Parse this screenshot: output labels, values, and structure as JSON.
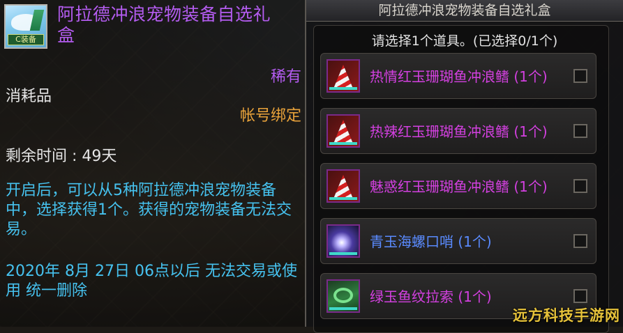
{
  "tooltip": {
    "item_name": "阿拉德冲浪宠物装备自选礼盒",
    "icon_badge": "C装备",
    "rarity": "稀有",
    "category": "消耗品",
    "binding": "帐号绑定",
    "remaining_time": "剩余时间 : 49天",
    "description": "开启后，可以从5种阿拉德冲浪宠物装备中，选择获得1个。获得的宠物装备无法交易。",
    "expire_note": "2020年 8月 27日 06点以后 无法交易或使用 统一删除",
    "colors": {
      "name": "#b45cf0",
      "binding": "#e8a23a",
      "description": "#46c2ef"
    }
  },
  "selector": {
    "title": "阿拉德冲浪宠物装备自选礼盒",
    "prompt": "请选择1个道具。(已选择0/1个)",
    "options": [
      {
        "label": "热情红玉珊瑚鱼冲浪鳍 (1个)",
        "icon": "red-surfboard-icon",
        "checked": false
      },
      {
        "label": "热辣红玉珊瑚鱼冲浪鳍 (1个)",
        "icon": "red-surfboard-icon",
        "checked": false
      },
      {
        "label": "魅惑红玉珊瑚鱼冲浪鳍 (1个)",
        "icon": "red-surfboard-icon",
        "checked": false
      },
      {
        "label": "青玉海螺口哨 (1个)",
        "icon": "conch-whistle-icon",
        "checked": false
      },
      {
        "label": "绿玉鱼纹拉索 (1个)",
        "icon": "green-rope-icon",
        "checked": false
      }
    ]
  },
  "watermark": "远方科技手游网"
}
